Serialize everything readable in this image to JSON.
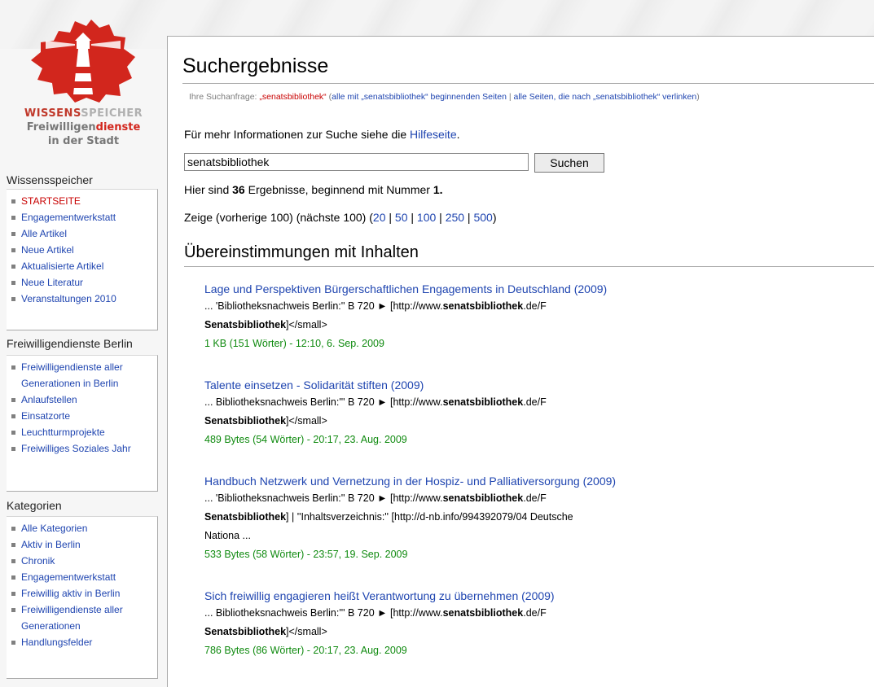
{
  "logo": {
    "line1_a": "WISSENS",
    "line1_b": "SPEICHER",
    "line2_a": "Freiwilligen",
    "line2_b": "dienste",
    "line3": "in der Stadt"
  },
  "sidebar": {
    "sections": [
      {
        "title": "Wissensspeicher",
        "items": [
          "STARTSEITE",
          "Engagementwerkstatt",
          "Alle Artikel",
          "Neue Artikel",
          "Aktualisierte Artikel",
          "Neue Literatur",
          "Veranstaltungen 2010"
        ]
      },
      {
        "title": "Freiwilligendienste Berlin",
        "items": [
          "Freiwilligendienste aller Generationen in Berlin",
          "Anlaufstellen",
          "Einsatzorte",
          "Leuchtturmprojekte",
          "Freiwilliges Soziales Jahr"
        ]
      },
      {
        "title": "Kategorien",
        "items": [
          "Alle Kategorien",
          "Aktiv in Berlin",
          "Chronik",
          "Engagementwerkstatt",
          "Freiwillig aktiv in Berlin",
          "Freiwilligendienste aller Generationen",
          "Handlungsfelder"
        ]
      }
    ]
  },
  "page": {
    "title": "Suchergebnisse",
    "subtitle_prefix": "Ihre Suchanfrage: ",
    "subtitle_query": "„senatsbibliothek“",
    "subtitle_open": " (",
    "subtitle_link1": "alle mit „senatsbibliothek“ beginnenden Seiten",
    "subtitle_sep": " | ",
    "subtitle_link2": "alle Seiten, die nach „senatsbibliothek“ verlinken",
    "subtitle_close": ")",
    "info_text": "Für mehr Informationen zur Suche siehe die ",
    "info_link": "Hilfeseite",
    "info_end": ".",
    "search_value": "senatsbibliothek",
    "search_button": "Suchen",
    "count_pre": "Hier sind ",
    "count_num": "36",
    "count_mid": " Ergebnisse, beginnend mit Nummer ",
    "count_start": "1.",
    "paging_pre": "Zeige (vorherige 100) (nächste 100) (",
    "paging_options": [
      "20",
      "50",
      "100",
      "250",
      "500"
    ],
    "paging_sep": " | ",
    "paging_post": ")",
    "section_heading": "Übereinstimmungen mit Inhalten"
  },
  "results": [
    {
      "title": "Lage und Perspektiven Bürgerschaftlichen Engagements in Deutschland (2009)",
      "snip1_pre": "... 'Bibliotheksnachweis Berlin:'' B 720 ► [http://www.",
      "snip1_bold": "senatsbibliothek",
      "snip1_post": ".de/F",
      "snip2_bold": "Senatsbibliothek",
      "snip2_post": "]</small>",
      "meta": "1 KB (151 Wörter) - 12:10, 6. Sep. 2009"
    },
    {
      "title": "Talente einsetzen - Solidarität stiften (2009)",
      "snip1_pre": "... Bibliotheksnachweis Berlin:''' B 720 ► [http://www.",
      "snip1_bold": "senatsbibliothek",
      "snip1_post": ".de/F",
      "snip2_bold": "Senatsbibliothek",
      "snip2_post": "]</small>",
      "meta": "489 Bytes (54 Wörter) - 20:17, 23. Aug. 2009"
    },
    {
      "title": "Handbuch Netzwerk und Vernetzung in der Hospiz- und Palliativersorgung (2009)",
      "snip1_pre": "... 'Bibliotheksnachweis Berlin:'' B 720 ► [http://www.",
      "snip1_bold": "senatsbibliothek",
      "snip1_post": ".de/F",
      "snip2_bold": "Senatsbibliothek",
      "snip2_post": "] | ''Inhaltsverzeichnis:'' [http://d-nb.info/994392079/04 Deutsche",
      "snip3": "Nationa ...",
      "meta": "533 Bytes (58 Wörter) - 23:57, 19. Sep. 2009"
    },
    {
      "title": "Sich freiwillig engagieren heißt Verantwortung zu übernehmen (2009)",
      "snip1_pre": "... Bibliotheksnachweis Berlin:''' B 720 ► [http://www.",
      "snip1_bold": "senatsbibliothek",
      "snip1_post": ".de/F",
      "snip2_bold": "Senatsbibliothek",
      "snip2_post": "]</small>",
      "meta": "786 Bytes (86 Wörter) - 20:17, 23. Aug. 2009"
    }
  ],
  "colors": {
    "link": "#1f45b0",
    "meta_green": "#0f8a0f",
    "query_red": "#c80000",
    "logo_red": "#d2261d"
  }
}
